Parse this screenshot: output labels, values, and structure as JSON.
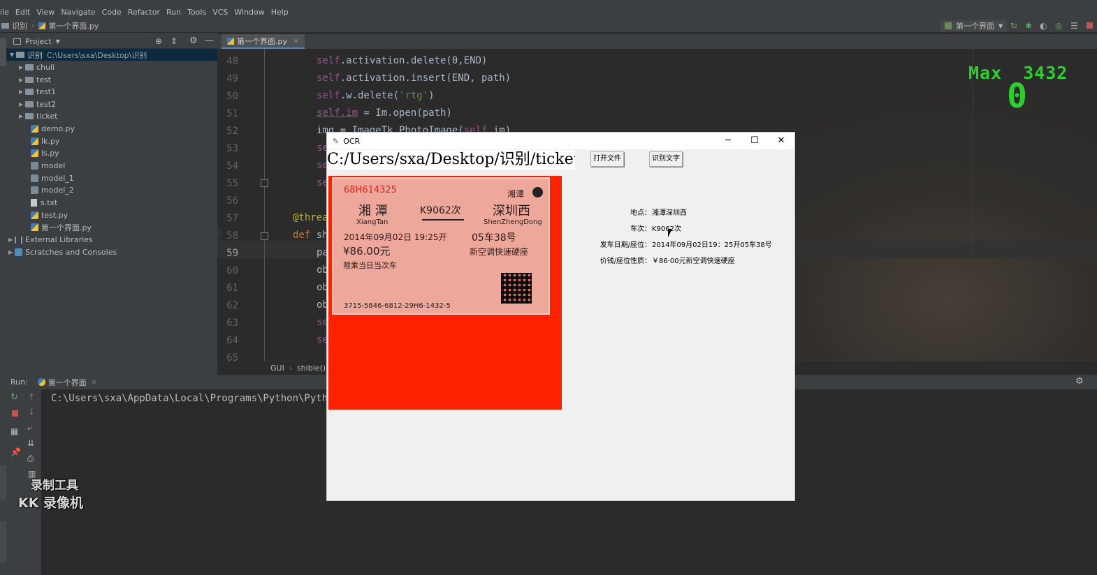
{
  "ide": {
    "menu": [
      "ile",
      "Edit",
      "View",
      "Navigate",
      "Code",
      "Refactor",
      "Run",
      "Tools",
      "VCS",
      "Window",
      "Help"
    ],
    "nav_root": "识别",
    "nav_file": "第一个界面.py",
    "run_config": "第一个界面",
    "project_label": "Project",
    "editor_tab": "第一个界面.py",
    "tree": {
      "root_name": "识别",
      "root_path": "C:\\Users\\sxa\\Desktop\\识别",
      "folders": [
        "chuli",
        "test",
        "test1",
        "test2",
        "ticket"
      ],
      "files": [
        "demo.py",
        "lk.py",
        "ls.py",
        "model",
        "model_1",
        "model_2",
        "s.txt",
        "test.py",
        "第一个界面.py"
      ],
      "external": "External Libraries",
      "scratches": "Scratches and Consoles"
    },
    "line_numbers": [
      "48",
      "49",
      "50",
      "51",
      "52",
      "53",
      "54",
      "55",
      "56",
      "57",
      "58",
      "59",
      "60",
      "61",
      "62",
      "63",
      "64",
      "65"
    ],
    "breadcrumb": [
      "GUI",
      "shibie()"
    ],
    "run_label": "Run:",
    "run_tab": "第一个界面",
    "run_output": "C:\\Users\\sxa\\AppData\\Local\\Programs\\Python\\Pyth"
  },
  "watermark": {
    "line1": "录制工具",
    "line2": "KK 录像机"
  },
  "game_overlay": {
    "max_label": "Max",
    "max_value": "3432",
    "score": "0"
  },
  "ocr_window": {
    "title": "OCR",
    "path_value": "C:/Users/sxa/Desktop/识别/ticket",
    "open_button": "打开文件",
    "recognize_button": "识别文字",
    "ticket": {
      "serial": "68H614325",
      "station_stamp": "湘潭",
      "from_cn": "湘 潭",
      "from_en": "XiangTan",
      "train": "K9062次",
      "to_cn": "深圳西",
      "to_en": "ShenZhengDong",
      "datetime": "2014年09月02日 19:25开",
      "seat": "05车38号",
      "price": "¥86.00元",
      "seat_class": "新空调快速硬座",
      "note": "限乘当日当次车",
      "code": "3715-5846-6812-29H6-1432-5"
    },
    "results": [
      {
        "label": "地点：",
        "value": "湘潭深圳西"
      },
      {
        "label": "车次：",
        "value": "K9062次"
      },
      {
        "label": "发车日期/座位：",
        "value": "2014年09月02日19：25开05车38号"
      },
      {
        "label": "价钱/座位性质：",
        "value": "￥86·00元新空调快速硬座"
      }
    ]
  }
}
